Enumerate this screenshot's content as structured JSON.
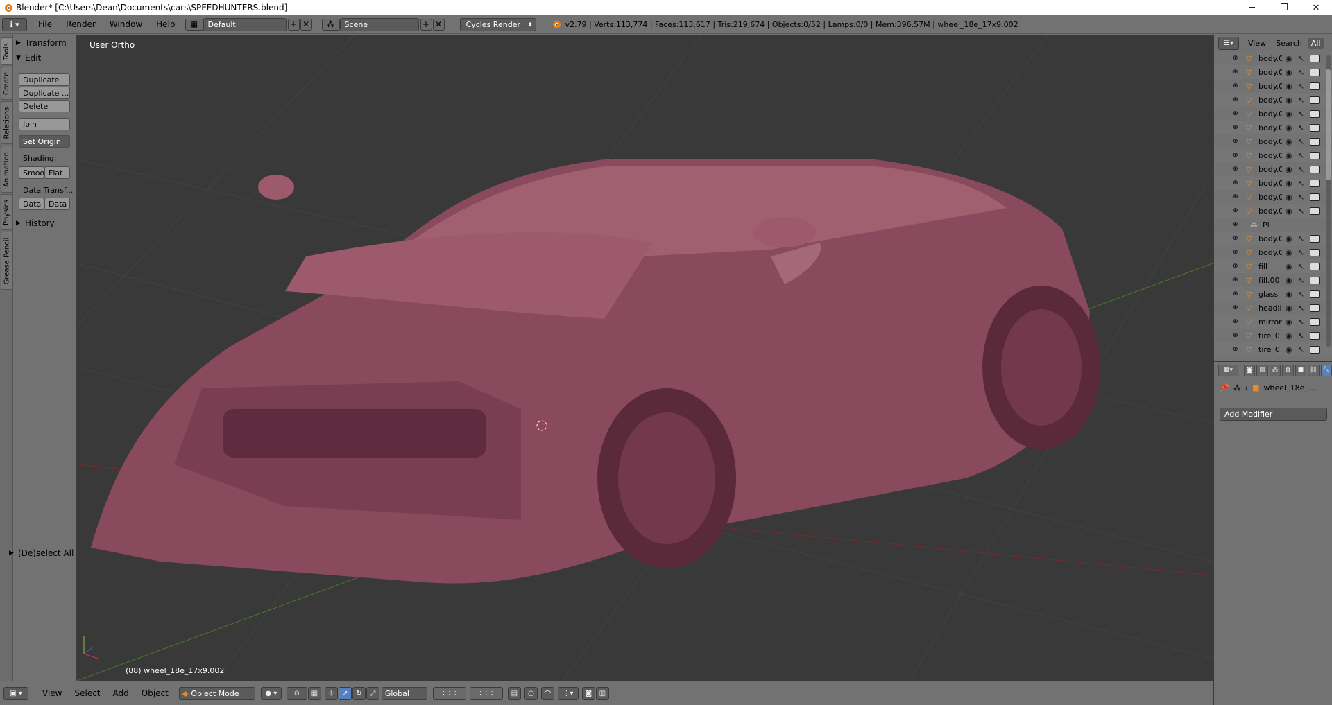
{
  "titlebar": {
    "title": "Blender* [C:\\Users\\Dean\\Documents\\cars\\SPEEDHUNTERS.blend]",
    "minimize": "─",
    "maximize": "❐",
    "close": "✕"
  },
  "info": {
    "menus": [
      "File",
      "Render",
      "Window",
      "Help"
    ],
    "screen_layout": "Default",
    "scene": "Scene",
    "render_engine": "Cycles Render",
    "stats": "v2.79 | Verts:113,774 | Faces:113,617 | Tris:219,674 | Objects:0/52 | Lamps:0/0 | Mem:396.57M | wheel_18e_17x9.002"
  },
  "toolshelf": {
    "tabs": [
      "Tools",
      "Create",
      "Relations",
      "Animation",
      "Physics",
      "Grease Pencil"
    ],
    "transform_panel": "Transform",
    "edit_panel": "Edit",
    "buttons": {
      "duplicate": "Duplicate",
      "duplicate_linked": "Duplicate ...",
      "delete": "Delete",
      "join": "Join",
      "set_origin": "Set Origin"
    },
    "shading_label": "Shading:",
    "smooth": "Smoo",
    "flat": "Flat",
    "data_transfer_label": "Data Transf...",
    "data1": "Data",
    "data2": "Data",
    "history_panel": "History",
    "deselect_all": "(De)select All"
  },
  "viewport": {
    "view_label": "User Ortho",
    "active_object": "(88) wheel_18e_17x9.002",
    "car_color": "#8a4a5e",
    "grid_color": "#3e3e3e"
  },
  "bottombar": {
    "menus": [
      "View",
      "Select",
      "Add",
      "Object"
    ],
    "mode": "Object Mode",
    "orientation": "Global"
  },
  "outliner": {
    "view": "View",
    "search": "Search",
    "filter": "All",
    "rows": [
      {
        "name": "body.0",
        "child": false
      },
      {
        "name": "body.0",
        "child": false
      },
      {
        "name": "body.0",
        "child": false
      },
      {
        "name": "body.0",
        "child": false
      },
      {
        "name": "body.0",
        "child": false
      },
      {
        "name": "body.0",
        "child": false
      },
      {
        "name": "body.0",
        "child": false
      },
      {
        "name": "body.0",
        "child": false
      },
      {
        "name": "body.0",
        "child": false
      },
      {
        "name": "body.0",
        "child": false
      },
      {
        "name": "body.0",
        "child": false
      },
      {
        "name": "body.0",
        "child": false
      },
      {
        "name": "Pl",
        "child": true
      },
      {
        "name": "body.0",
        "child": false
      },
      {
        "name": "body.0",
        "child": false
      },
      {
        "name": "fill",
        "child": false
      },
      {
        "name": "fill.00",
        "child": false
      },
      {
        "name": "glass",
        "child": false
      },
      {
        "name": "headli",
        "child": false
      },
      {
        "name": "mirror",
        "child": false
      },
      {
        "name": "tire_0",
        "child": false
      },
      {
        "name": "tire_0",
        "child": false
      }
    ]
  },
  "properties": {
    "context_object": "wheel_18e_...",
    "add_modifier": "Add Modifier"
  }
}
